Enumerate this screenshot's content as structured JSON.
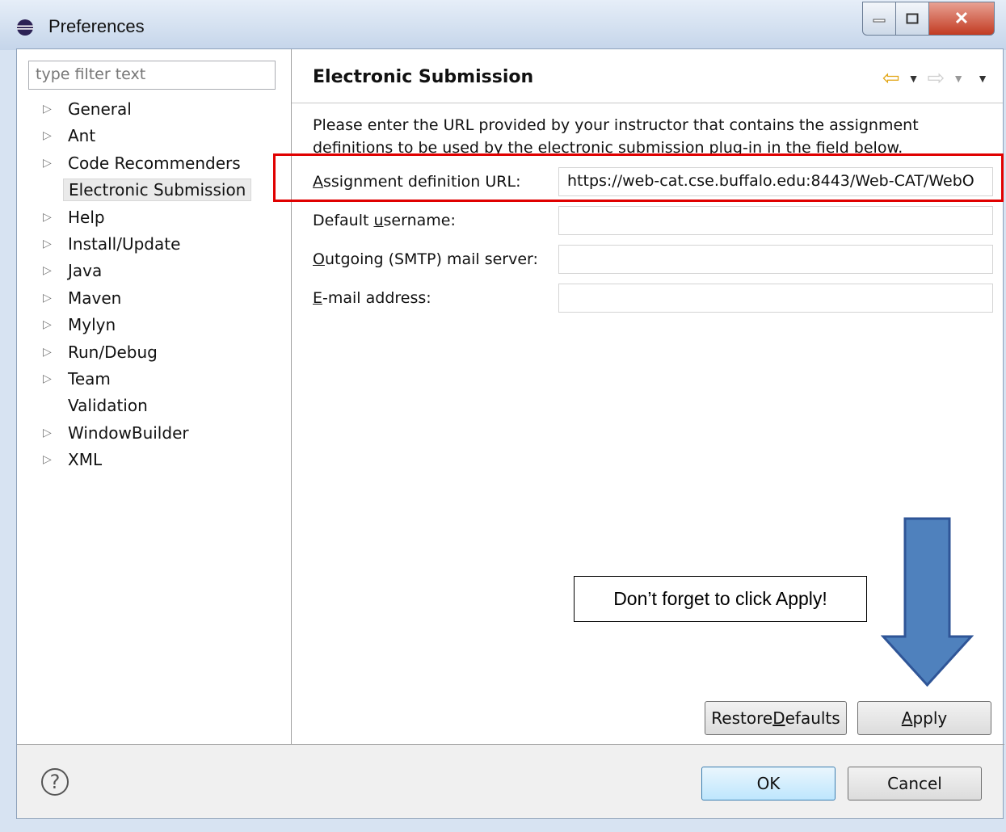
{
  "window": {
    "title": "Preferences"
  },
  "filter": {
    "placeholder": "type filter text"
  },
  "tree": {
    "items": [
      {
        "label": "General",
        "expandable": true
      },
      {
        "label": "Ant",
        "expandable": true
      },
      {
        "label": "Code Recommenders",
        "expandable": true
      },
      {
        "label": "Electronic Submission",
        "expandable": false,
        "selected": true
      },
      {
        "label": "Help",
        "expandable": true
      },
      {
        "label": "Install/Update",
        "expandable": true
      },
      {
        "label": "Java",
        "expandable": true
      },
      {
        "label": "Maven",
        "expandable": true
      },
      {
        "label": "Mylyn",
        "expandable": true
      },
      {
        "label": "Run/Debug",
        "expandable": true
      },
      {
        "label": "Team",
        "expandable": true
      },
      {
        "label": "Validation",
        "expandable": false
      },
      {
        "label": "WindowBuilder",
        "expandable": true
      },
      {
        "label": "XML",
        "expandable": true
      }
    ]
  },
  "page": {
    "title": "Electronic Submission",
    "description": "Please enter the URL provided by your instructor that contains the assignment definitions to be used by the electronic submission plug-in in the field below.",
    "fields": [
      {
        "label": "Assignment definition URL:",
        "mnemonic": "A",
        "rest": "ssignment definition URL:",
        "value": "https://web-cat.cse.buffalo.edu:8443/Web-CAT/WebO"
      },
      {
        "label": "Default username:",
        "prefix": "Default ",
        "mnemonic": "u",
        "rest": "sername:",
        "value": ""
      },
      {
        "label": "Outgoing (SMTP) mail server:",
        "mnemonic": "O",
        "rest": "utgoing (SMTP) mail server:",
        "value": ""
      },
      {
        "label": "E-mail address:",
        "mnemonic": "E",
        "rest": "-mail address:",
        "value": ""
      }
    ]
  },
  "buttons": {
    "restore_prefix": "Restore ",
    "restore_mnemonic": "D",
    "restore_rest": "efaults",
    "apply_mnemonic": "A",
    "apply_rest": "pply",
    "ok": "OK",
    "cancel": "Cancel"
  },
  "annotation": {
    "callout": "Don’t forget to click Apply!",
    "highlight_color": "#e00000",
    "arrow_color": "#4f81bd"
  }
}
